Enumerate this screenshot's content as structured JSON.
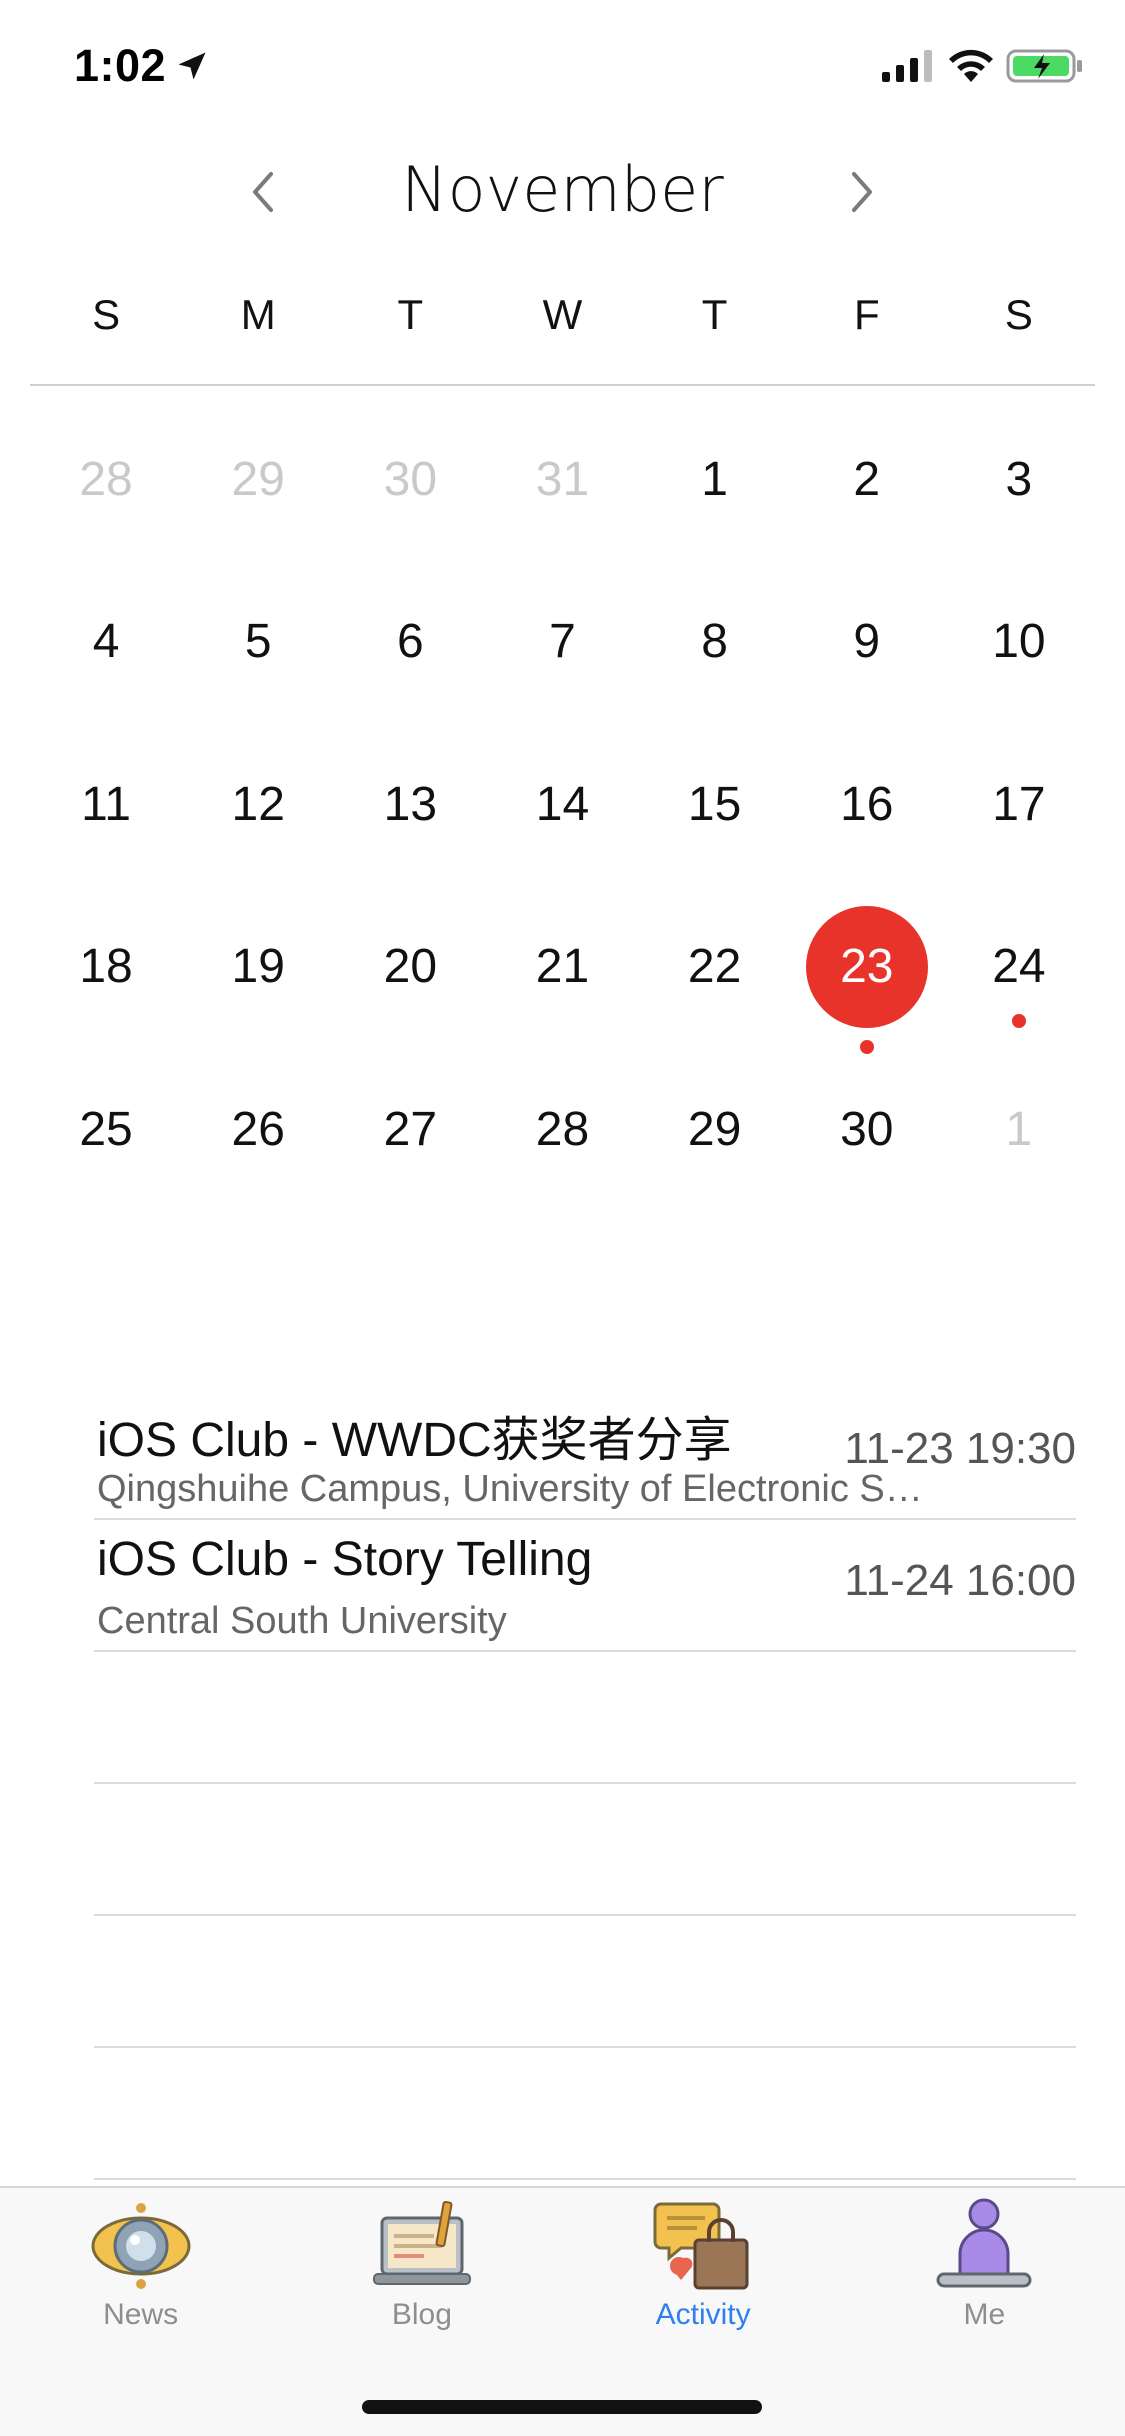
{
  "status_bar": {
    "time": "1:02",
    "icons": [
      "location-arrow-icon",
      "signal-icon",
      "wifi-icon",
      "battery-charging-icon"
    ]
  },
  "calendar": {
    "month": "November",
    "prev_icon": "chevron-left-icon",
    "next_icon": "chevron-right-icon",
    "weekdays": [
      "S",
      "M",
      "T",
      "W",
      "T",
      "F",
      "S"
    ],
    "weeks": [
      [
        {
          "d": "28",
          "m": true
        },
        {
          "d": "29",
          "m": true
        },
        {
          "d": "30",
          "m": true
        },
        {
          "d": "31",
          "m": true
        },
        {
          "d": "1"
        },
        {
          "d": "2"
        },
        {
          "d": "3"
        }
      ],
      [
        {
          "d": "4"
        },
        {
          "d": "5"
        },
        {
          "d": "6"
        },
        {
          "d": "7"
        },
        {
          "d": "8"
        },
        {
          "d": "9"
        },
        {
          "d": "10"
        }
      ],
      [
        {
          "d": "11"
        },
        {
          "d": "12"
        },
        {
          "d": "13"
        },
        {
          "d": "14"
        },
        {
          "d": "15"
        },
        {
          "d": "16"
        },
        {
          "d": "17"
        }
      ],
      [
        {
          "d": "18"
        },
        {
          "d": "19"
        },
        {
          "d": "20"
        },
        {
          "d": "21"
        },
        {
          "d": "22"
        },
        {
          "d": "23",
          "selected": true,
          "event": true
        },
        {
          "d": "24",
          "event": true
        }
      ],
      [
        {
          "d": "25"
        },
        {
          "d": "26"
        },
        {
          "d": "27"
        },
        {
          "d": "28"
        },
        {
          "d": "29"
        },
        {
          "d": "30"
        },
        {
          "d": "1",
          "m": true
        }
      ]
    ],
    "accent_color": "#e8332a"
  },
  "events": [
    {
      "title": "iOS Club - WWDC获奖者分享",
      "location": "Qingshuihe Campus, University of Electronic Science and Technology of China",
      "time": "11-23 19:30"
    },
    {
      "title": "iOS Club - Story Telling",
      "location": "Central South University",
      "time": "11-24 16:00"
    }
  ],
  "tab_bar": {
    "active_color": "#2f7ff0",
    "tabs": [
      {
        "label": "News",
        "icon": "news-eye-icon"
      },
      {
        "label": "Blog",
        "icon": "blog-laptop-icon"
      },
      {
        "label": "Activity",
        "icon": "activity-chat-bag-icon",
        "active": true
      },
      {
        "label": "Me",
        "icon": "me-person-icon"
      }
    ]
  }
}
